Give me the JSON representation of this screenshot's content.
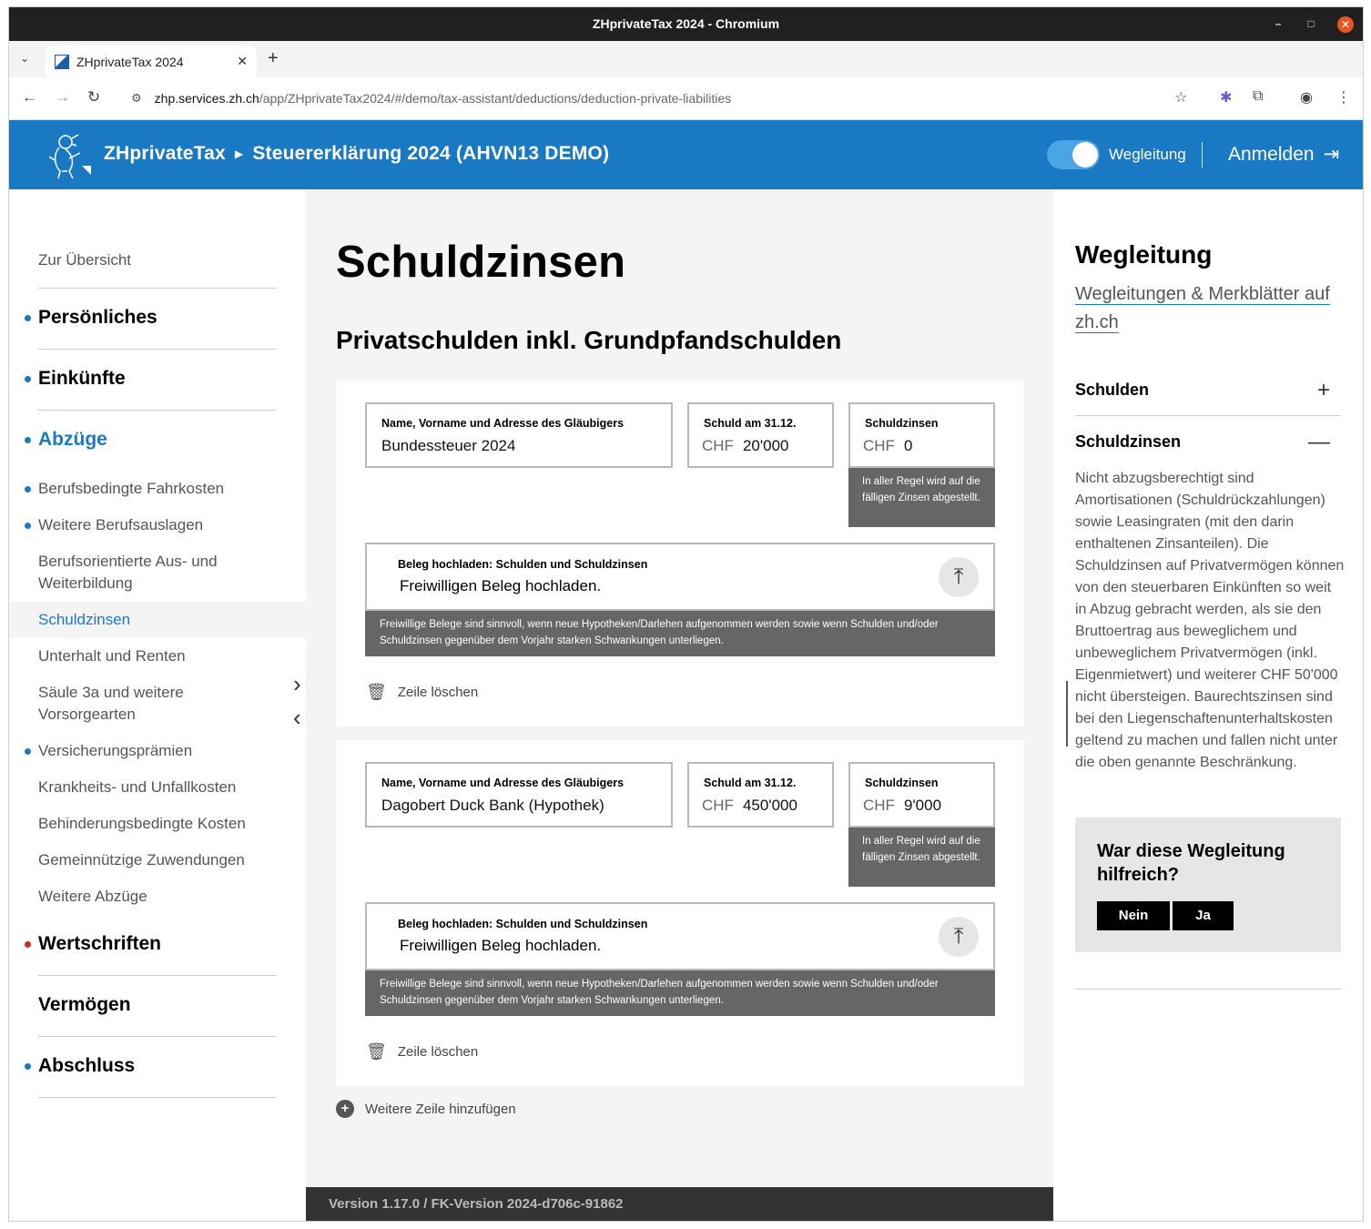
{
  "browser": {
    "window_title": "ZHprivateTax 2024 - Chromium",
    "tab_title": "ZHprivateTax 2024",
    "url_host": "zhp.services.zh.ch",
    "url_path": "/app/ZHprivateTax2024/#/demo/tax-assistant/deductions/deduction-private-liabilities"
  },
  "header": {
    "app_name": "ZHprivateTax",
    "breadcrumb": "Steuererklärung 2024 (AHVN13 DEMO)",
    "guidance_label": "Wegleitung",
    "login_label": "Anmelden"
  },
  "nav": {
    "overview": "Zur Übersicht",
    "personal": "Persönliches",
    "income": "Einkünfte",
    "deductions": "Abzüge",
    "sub": [
      "Berufsbedingte Fahrkosten",
      "Weitere Berufsauslagen",
      "Berufsorientierte Aus- und Weiterbildung",
      "Schuldzinsen",
      "Unterhalt und Renten",
      "Säule 3a und weitere Vorsorgearten",
      "Versicherungsprämien",
      "Krankheits- und Unfallkosten",
      "Behinderungsbedingte Kosten",
      "Gemeinnützige Zuwendungen",
      "Weitere Abzüge"
    ],
    "securities": "Wertschriften",
    "assets": "Vermögen",
    "closing": "Abschluss"
  },
  "main": {
    "title": "Schuldzinsen",
    "section_title": "Privatschulden inkl. Grundpfandschulden",
    "labels": {
      "creditor": "Name, Vorname und Adresse des Gläubigers",
      "debt": "Schuld am 31.12.",
      "interest": "Schuldzinsen",
      "currency": "CHF",
      "interest_hint": "In aller Regel wird auf die fälligen Zinsen abgestellt.",
      "upload_label": "Beleg hochladen: Schulden und Schuldzinsen",
      "upload_text": "Freiwilligen Beleg hochladen.",
      "upload_hint": "Freiwillige Belege sind sinnvoll, wenn neue Hypotheken/Darlehen aufgenommen werden sowie wenn Schulden und/oder Schuldzinsen gegenüber dem Vorjahr starken Schwankungen unterliegen.",
      "delete_row": "Zeile löschen",
      "add_row": "Weitere Zeile hinzufügen"
    },
    "rows": [
      {
        "creditor": "Bundessteuer 2024",
        "debt": "20'000",
        "interest": "0"
      },
      {
        "creditor": "Dagobert Duck Bank (Hypothek)",
        "debt": "450'000",
        "interest": "9'000"
      }
    ],
    "footer": "Version 1.17.0 / FK-Version 2024-d706c-91862"
  },
  "aside": {
    "title": "Wegleitung",
    "link": "Wegleitungen & Merkblätter auf zh.ch",
    "acc_debts": "Schulden",
    "acc_interest": "Schuldzinsen",
    "body": "Nicht abzugsberechtigt sind Amortisationen (Schuldrückzahlungen) sowie Leasingraten (mit den darin enthaltenen Zinsanteilen). Die Schuldzinsen auf Privatvermögen können von den steuerbaren Einkünften so weit in Abzug gebracht werden, als sie den Bruttoertrag aus beweglichem und unbeweglichem Privatvermögen (inkl. Eigenmietwert) und weiterer CHF 50'000 nicht übersteigen. Baurechtszinsen sind bei den Liegenschaftenunterhaltskosten geltend zu machen und fallen nicht unter die oben genannte Beschränkung.",
    "feedback_q": "War diese Wegleitung hilfreich?",
    "no": "Nein",
    "yes": "Ja"
  }
}
